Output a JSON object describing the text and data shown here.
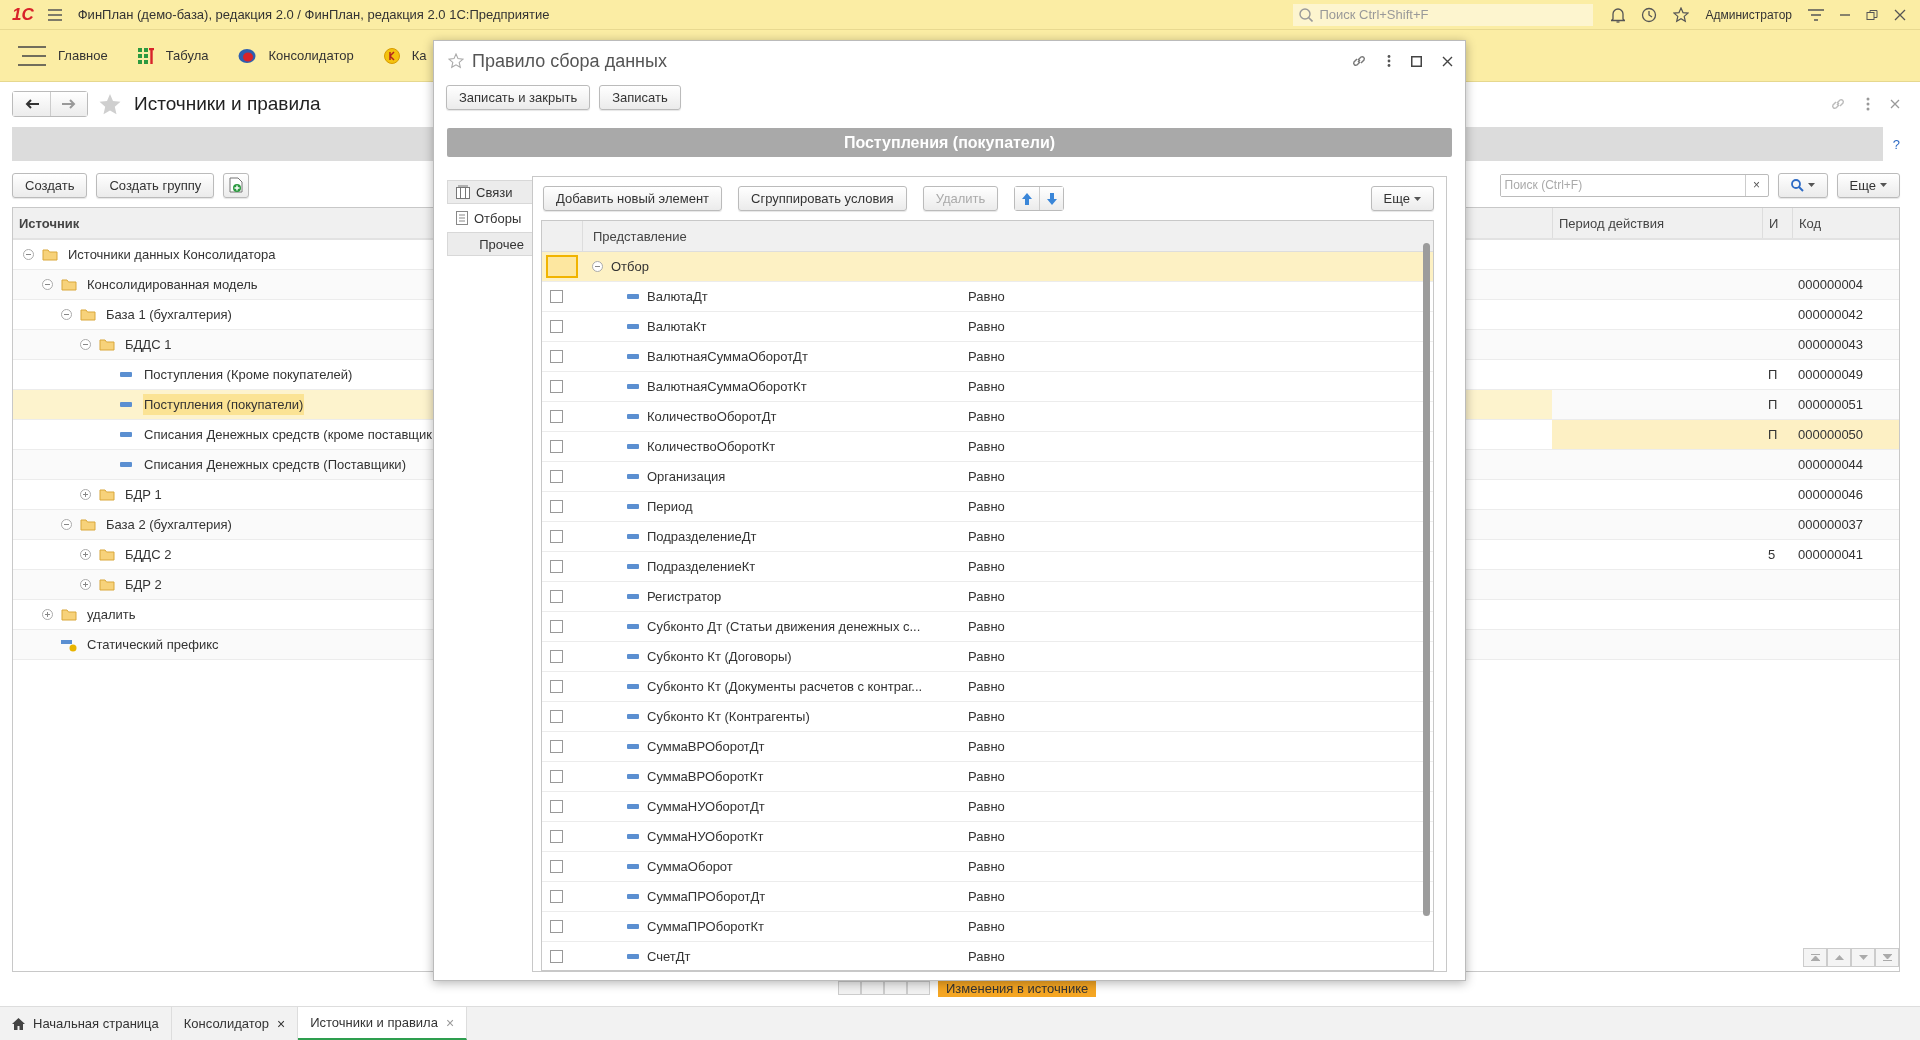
{
  "app_bar": {
    "logo": "1С",
    "title": "ФинПлан (демо-база), редакция 2.0 / ФинПлан, редакция 2.0 1С:Предприятие",
    "search": {
      "placeholder": "Поиск Ctrl+Shift+F"
    },
    "user": "Администратор"
  },
  "sections": [
    {
      "label": "Главное",
      "kind": "menu"
    },
    {
      "label": "Табула",
      "kind": "tabula"
    },
    {
      "label": "Консолидатор",
      "kind": "consolidator"
    },
    {
      "label": "Ка",
      "kind": "coin"
    }
  ],
  "form": {
    "title": "Источники и правила",
    "help": "?",
    "buttons": [
      "Создать",
      "Создать группу"
    ],
    "search": {
      "placeholder": "Поиск (Ctrl+F)",
      "clear": "×"
    },
    "more": "Еще",
    "columns": [
      "Источник",
      "Период действия",
      "И",
      "Код"
    ],
    "tree": [
      {
        "label": "Источники данных Консолидатора",
        "kind": "folder",
        "expanded": true,
        "selected": false,
        "current": false,
        "children": [
          {
            "label": "Консолидированная модель",
            "kind": "folder",
            "expanded": true,
            "code": "000000004",
            "selected": false,
            "current": false,
            "children": [
              {
                "label": "База 1 (бухгалтерия)",
                "kind": "folder",
                "expanded": true,
                "code": "000000042",
                "selected": false,
                "current": false,
                "children": [
                  {
                    "label": "БДДС 1",
                    "kind": "folder",
                    "expanded": true,
                    "code": "000000043",
                    "selected": false,
                    "current": false,
                    "children": [
                      {
                        "label": "Поступления (Кроме покупателей)",
                        "kind": "item",
                        "flag": "П",
                        "code": "000000049",
                        "selected": false,
                        "current": false
                      },
                      {
                        "label": "Поступления (покупатели)",
                        "kind": "item",
                        "flag": "П",
                        "code": "000000051",
                        "selected": true,
                        "current": false
                      },
                      {
                        "label": "Списания Денежных средств (кроме поставщик",
                        "kind": "item",
                        "flag": "П",
                        "code": "000000050",
                        "selected": false,
                        "current": true
                      },
                      {
                        "label": "Списания Денежных средств (Поставщики)",
                        "kind": "item",
                        "code": "000000044",
                        "selected": false,
                        "current": false
                      }
                    ]
                  },
                  {
                    "label": "БДР 1",
                    "kind": "folder",
                    "expanded": false,
                    "code": "000000046",
                    "selected": false,
                    "current": false
                  }
                ]
              },
              {
                "label": "База 2 (бухгалтерия)",
                "kind": "folder",
                "expanded": true,
                "code": "000000037",
                "selected": false,
                "current": false,
                "children": [
                  {
                    "label": "БДДС 2",
                    "kind": "folder",
                    "expanded": false,
                    "flag": "5",
                    "code": "000000041",
                    "selected": false,
                    "current": false
                  },
                  {
                    "label": "БДР 2",
                    "kind": "folder",
                    "expanded": false,
                    "selected": false,
                    "current": false
                  }
                ]
              }
            ]
          },
          {
            "label": "удалить",
            "kind": "folder",
            "expanded": false,
            "selected": false,
            "current": false
          },
          {
            "label": "Статический префикс",
            "kind": "prefix",
            "selected": false,
            "current": false
          }
        ]
      }
    ],
    "status": "Изменения в источнике"
  },
  "dialog": {
    "title": "Правило сбора данных",
    "buttons": [
      "Записать и закрыть",
      "Записать"
    ],
    "heading": "Поступления (покупатели)",
    "side_tabs": [
      {
        "label": "Связи",
        "kind": "links",
        "selected": false
      },
      {
        "label": "Отборы",
        "kind": "filter",
        "selected": true
      },
      {
        "label": "Прочее",
        "kind": "plain",
        "selected": false
      }
    ],
    "toolbar": [
      {
        "label": "Добавить новый элемент",
        "disabled": false
      },
      {
        "label": "Сгруппировать условия",
        "disabled": false
      },
      {
        "label": "Удалить",
        "disabled": true
      }
    ],
    "more": "Еще",
    "table": {
      "column": "Представление",
      "group": {
        "label": "Отбор",
        "expanded": true,
        "selected": true
      },
      "rows": [
        {
          "field": "ВалютаДт",
          "condition": "Равно",
          "checked": false
        },
        {
          "field": "ВалютаКт",
          "condition": "Равно",
          "checked": false
        },
        {
          "field": "ВалютнаяСуммаОборотДт",
          "condition": "Равно",
          "checked": false
        },
        {
          "field": "ВалютнаяСуммаОборотКт",
          "condition": "Равно",
          "checked": false
        },
        {
          "field": "КоличествоОборотДт",
          "condition": "Равно",
          "checked": false
        },
        {
          "field": "КоличествоОборотКт",
          "condition": "Равно",
          "checked": false
        },
        {
          "field": "Организация",
          "condition": "Равно",
          "checked": false
        },
        {
          "field": "Период",
          "condition": "Равно",
          "checked": false
        },
        {
          "field": "ПодразделениеДт",
          "condition": "Равно",
          "checked": false
        },
        {
          "field": "ПодразделениеКт",
          "condition": "Равно",
          "checked": false
        },
        {
          "field": "Регистратор",
          "condition": "Равно",
          "checked": false
        },
        {
          "field": "Субконто Дт (Статьи движения денежных с...",
          "condition": "Равно",
          "checked": false
        },
        {
          "field": "Субконто Кт (Договоры)",
          "condition": "Равно",
          "checked": false
        },
        {
          "field": "Субконто Кт (Документы расчетов с контраг...",
          "condition": "Равно",
          "checked": false
        },
        {
          "field": "Субконто Кт (Контрагенты)",
          "condition": "Равно",
          "checked": false
        },
        {
          "field": "СуммаВРОборотДт",
          "condition": "Равно",
          "checked": false
        },
        {
          "field": "СуммаВРОборотКт",
          "condition": "Равно",
          "checked": false
        },
        {
          "field": "СуммаНУОборотДт",
          "condition": "Равно",
          "checked": false
        },
        {
          "field": "СуммаНУОборотКт",
          "condition": "Равно",
          "checked": false
        },
        {
          "field": "СуммаОборот",
          "condition": "Равно",
          "checked": false
        },
        {
          "field": "СуммаПРОборотДт",
          "condition": "Равно",
          "checked": false
        },
        {
          "field": "СуммаПРОборотКт",
          "condition": "Равно",
          "checked": false
        },
        {
          "field": "СчетДт",
          "condition": "Равно",
          "checked": false
        }
      ]
    }
  },
  "open_tabs": [
    {
      "label": "Начальная страница",
      "kind": "home",
      "selected": false
    },
    {
      "label": "Консолидатор",
      "kind": "closable",
      "close": "×",
      "selected": false
    },
    {
      "label": "Источники и правила",
      "kind": "closable",
      "close": "×",
      "selected": true
    }
  ]
}
